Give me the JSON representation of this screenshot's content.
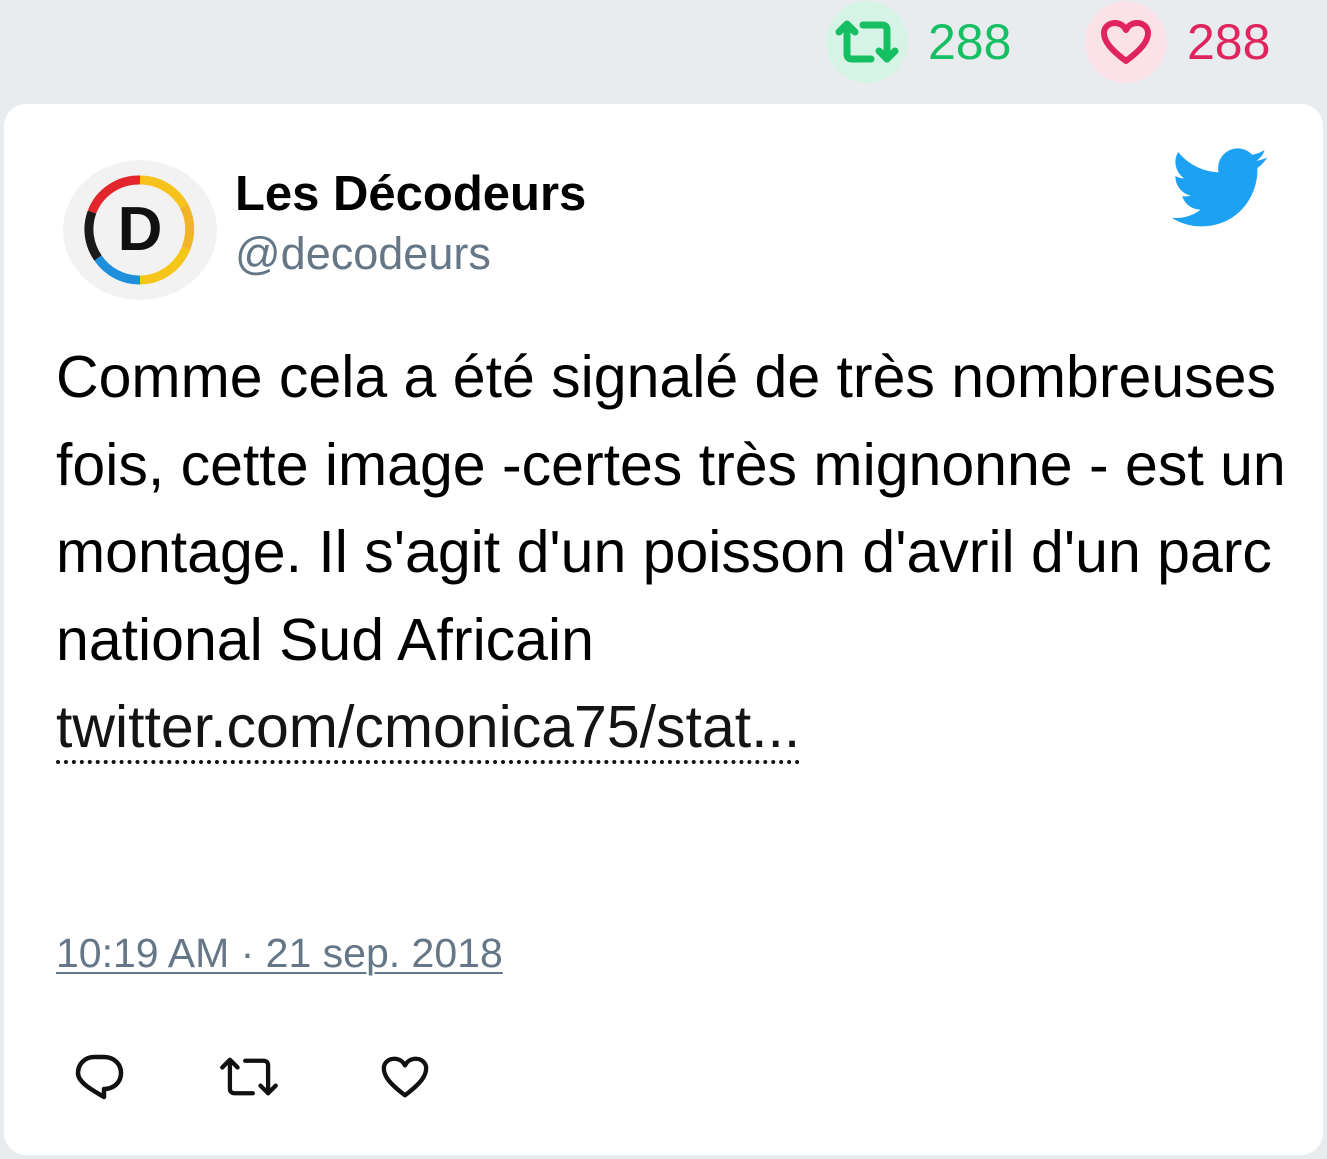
{
  "stats": {
    "retweet_count": "288",
    "like_count": "288",
    "retweet_icon": "retweet-icon",
    "like_icon": "heart-icon"
  },
  "tweet": {
    "display_name": "Les Décodeurs",
    "handle": "@decodeurs",
    "avatar_letter": "D",
    "text": "Comme cela a été signalé de très nombreuses fois, cette image -certes très mignonne - est un montage. Il s'agit d'un poisson d'avril d'un parc national Sud Africain",
    "link_text": "twitter.com/cmonica75/stat...",
    "timestamp": "10:19 AM · 21 sep. 2018"
  },
  "actions": {
    "reply_icon": "reply-icon",
    "retweet_icon": "retweet-icon",
    "like_icon": "heart-icon"
  },
  "colors": {
    "page_background": "#e9ecef",
    "card_background": "#ffffff",
    "retweet_green": "#17bf63",
    "like_red": "#e0245e",
    "twitter_blue": "#1da1f2",
    "handle_gray": "#657786"
  }
}
